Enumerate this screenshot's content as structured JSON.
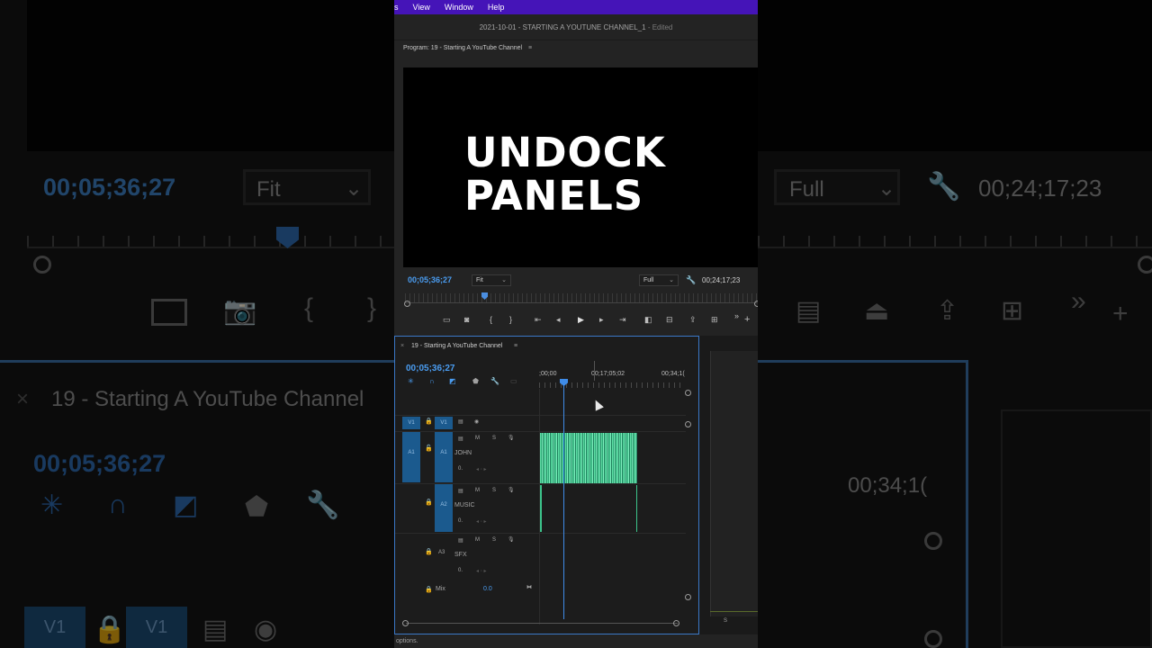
{
  "menu": {
    "items": [
      "s",
      "View",
      "Window",
      "Help"
    ]
  },
  "window": {
    "title": "2021-10-01 - STARTING A YOUTUNE CHANNEL_1",
    "status": "- Edited"
  },
  "program_monitor": {
    "header": "Program: 19 - Starting A YouTube Channel",
    "overlay_line1": "UNDOCK",
    "overlay_line2": "PANELS",
    "timecode": "00;05;36;27",
    "zoom": "Fit",
    "resolution": "Full",
    "duration": "00;24;17;23"
  },
  "transport": {
    "buttons": [
      "safe-margins",
      "export-frame",
      "mark-in",
      "mark-out",
      "go-to-in",
      "step-back",
      "play",
      "step-forward",
      "go-to-out",
      "insert",
      "overwrite",
      "lift",
      "extract",
      "more",
      "add"
    ],
    "more_label": "»",
    "add_label": "+"
  },
  "timeline": {
    "tab_close": "×",
    "sequence_name": "19 - Starting A YouTube Channel",
    "timecode": "00;05;36;27",
    "ruler": [
      ";00;00",
      "00;17;05;02",
      "00;34;1("
    ],
    "tracks": [
      {
        "source": "V1",
        "target": "V1"
      },
      {
        "source": "A1",
        "target": "A1",
        "name": "JOHN",
        "m": "M",
        "s": "S"
      },
      {
        "target": "A2",
        "name": "MUSIC",
        "m": "M",
        "s": "S"
      },
      {
        "target": "A3",
        "name": "SFX",
        "m": "M",
        "s": "S"
      }
    ],
    "volume_glyph": "0.",
    "mix": {
      "label": "Mix",
      "value": "0.0"
    }
  },
  "side_panel": {
    "label": "S"
  },
  "status": {
    "text": "options."
  },
  "background": {
    "timecode_left": "00;05;36;27",
    "zoom_left": "Fit",
    "resolution_right": "Full",
    "duration_right": "00;24;17;23",
    "sequence_name": "19 - Starting A YouTube Channel",
    "timecode_bottom": "00;05;36;27",
    "ruler_right": "00;34;1(",
    "chip_v1a": "V1",
    "chip_v1b": "V1"
  },
  "colors": {
    "menubar": "#4514b8",
    "timecode_blue": "#4a9cf0",
    "track_chip": "#1b5a8e",
    "audio_clip": "#1d7f5c",
    "panel_focus_border": "#3b78c7"
  }
}
